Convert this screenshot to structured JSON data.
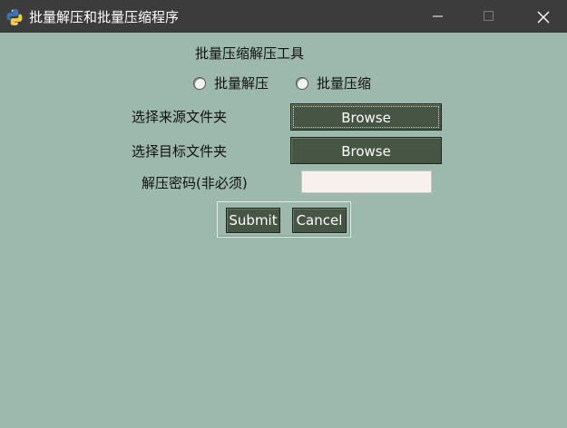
{
  "window": {
    "title": "批量解压和批量压缩程序",
    "app_icon": "python-icon",
    "controls": [
      "minimize-icon",
      "maximize-icon",
      "close-icon"
    ]
  },
  "form": {
    "heading": "批量压缩解压工具",
    "mode_options": [
      {
        "label": "批量解压",
        "selected": false
      },
      {
        "label": "批量压缩",
        "selected": false
      }
    ],
    "source_label": "选择来源文件夹",
    "source_button": "Browse",
    "target_label": "选择目标文件夹",
    "target_button": "Browse",
    "password_label": "解压密码(非必须)",
    "password_value": "",
    "submit_label": "Submit",
    "cancel_label": "Cancel"
  },
  "colors": {
    "titlebar": "#3c3c3c",
    "background": "#9db9ad",
    "button": "#475644",
    "input_background": "#f6f1ed"
  }
}
